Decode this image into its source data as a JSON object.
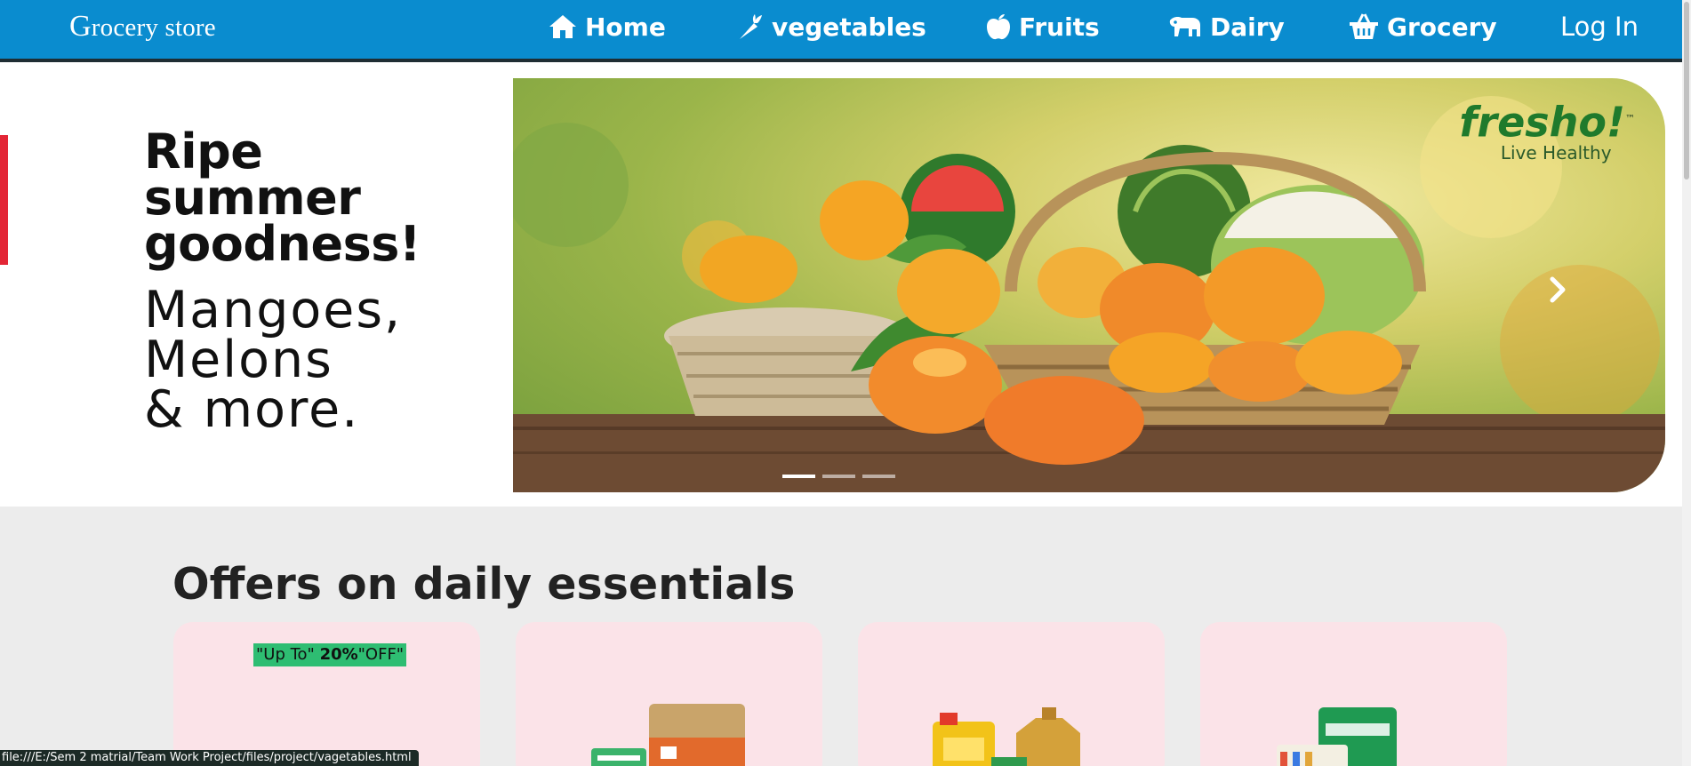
{
  "navbar": {
    "brand_initial": "G",
    "brand_rest": "rocery store",
    "items": [
      {
        "label": "Home",
        "icon": "home-icon"
      },
      {
        "label": "vegetables",
        "icon": "carrot-icon"
      },
      {
        "label": "Fruits",
        "icon": "apple-icon"
      },
      {
        "label": "Dairy",
        "icon": "cow-icon"
      },
      {
        "label": "Grocery",
        "icon": "basket-icon"
      }
    ],
    "login_label": "Log In",
    "bg_color": "#0a8ccf"
  },
  "hero": {
    "headline_lines": [
      "Ripe",
      "summer",
      "goodness!"
    ],
    "subline_lines": [
      "Mangoes,",
      "Melons",
      "& more."
    ],
    "logo_name": "fresho!",
    "logo_trademark": "™",
    "logo_tagline": "Live Healthy",
    "next_icon": "chevron-right-icon",
    "slide_count": 3,
    "active_slide": 1
  },
  "offers": {
    "title": "Offers on daily essentials",
    "badge_prefix": "\"Up To\" ",
    "badge_value": "20%",
    "badge_suffix": "\"OFF\"",
    "card_color": "#fbe3e8",
    "badge_color": "#2ebd72"
  },
  "status_bar": {
    "url": "file:///E:/Sem 2 matrial/Team Work Project/files/project/vagetables.html"
  }
}
